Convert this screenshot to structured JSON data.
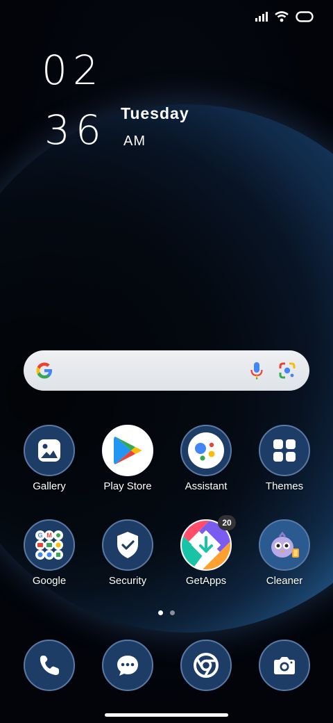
{
  "status_bar": {
    "icons": [
      "signal-icon",
      "wifi-icon",
      "battery-icon"
    ]
  },
  "clock": {
    "hour": "02",
    "minute": "36",
    "day": "Tuesday",
    "ampm": "AM"
  },
  "search": {
    "icons": [
      "google-logo-icon",
      "microphone-icon",
      "lens-icon"
    ]
  },
  "apps": [
    {
      "label": "Gallery",
      "icon": "gallery-icon"
    },
    {
      "label": "Play Store",
      "icon": "play-store-icon"
    },
    {
      "label": "Assistant",
      "icon": "assistant-icon"
    },
    {
      "label": "Themes",
      "icon": "themes-icon"
    },
    {
      "label": "Google",
      "icon": "google-folder-icon"
    },
    {
      "label": "Security",
      "icon": "security-icon"
    },
    {
      "label": "GetApps",
      "icon": "getapps-icon",
      "badge": "20"
    },
    {
      "label": "Cleaner",
      "icon": "cleaner-icon"
    }
  ],
  "page_indicator": {
    "pages": 2,
    "active": 1
  },
  "dock": [
    {
      "icon": "phone-icon"
    },
    {
      "icon": "messages-icon"
    },
    {
      "icon": "chrome-icon"
    },
    {
      "icon": "camera-icon"
    }
  ],
  "colors": {
    "icon_bg": "#1e3d66",
    "icon_border": "#5a7aa5",
    "badge": "#333333"
  }
}
